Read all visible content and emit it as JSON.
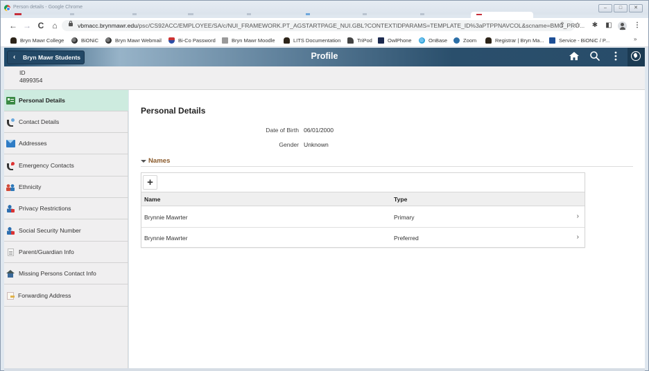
{
  "window": {
    "title": "Person details - Google Chrome",
    "controls": {
      "minimize": "–",
      "maximize": "□",
      "close": "✕"
    }
  },
  "browser": {
    "nav": {
      "back": "←",
      "forward": "→",
      "reload": "C",
      "home": "⌂"
    },
    "url_host": "vbmacc.brynmawr.edu",
    "url_path": "/psc/CS92ACC/EMPLOYEE/SA/c/NUI_FRAMEWORK.PT_AGSTARTPAGE_NUI.GBL?CONTEXTIDPARAMS=TEMPLATE_ID%3aPTPPNAVCOL&scname=BMC_PRO...",
    "icons": [
      "share-icon",
      "star-icon",
      "extensions-icon",
      "side-panel-icon",
      "profile-avatar",
      "menu-icon"
    ],
    "bookmarks": [
      {
        "label": "Bryn Mawr College",
        "icon": "owl"
      },
      {
        "label": "BiONiC",
        "icon": "globe"
      },
      {
        "label": "Bryn Mawr Webmail",
        "icon": "globe"
      },
      {
        "label": "Bi-Co Password",
        "icon": "shield"
      },
      {
        "label": "Bryn Mawr Moodle",
        "icon": "moodle"
      },
      {
        "label": "LITS Documentation",
        "icon": "owl"
      },
      {
        "label": "TriPod",
        "icon": "tripod"
      },
      {
        "label": "OwlPhone",
        "icon": "owlphone"
      },
      {
        "label": "OnBase",
        "icon": "onbase"
      },
      {
        "label": "Zoom",
        "icon": "wp"
      },
      {
        "label": "Registrar | Bryn Ma...",
        "icon": "owl"
      },
      {
        "label": "Service - BiONiC / P...",
        "icon": "td"
      }
    ],
    "bookmarks_more": "»"
  },
  "header": {
    "back_label": "Bryn Mawr Students",
    "title": "Profile",
    "icons": [
      "home-icon",
      "search-icon",
      "more-actions-icon",
      "navbar-compass-icon"
    ]
  },
  "id_bar": {
    "label": "ID",
    "value": "4899354"
  },
  "sidebar": {
    "items": [
      {
        "label": "Personal Details",
        "icon": "card",
        "active": true
      },
      {
        "label": "Contact Details",
        "icon": "phone"
      },
      {
        "label": "Addresses",
        "icon": "mail"
      },
      {
        "label": "Emergency Contacts",
        "icon": "phone-red"
      },
      {
        "label": "Ethnicity",
        "icon": "people"
      },
      {
        "label": "Privacy Restrictions",
        "icon": "person"
      },
      {
        "label": "Social Security Number",
        "icon": "person"
      },
      {
        "label": "Parent/Guardian Info",
        "icon": "doc"
      },
      {
        "label": "Missing Persons Contact Info",
        "icon": "house"
      },
      {
        "label": "Forwarding Address",
        "icon": "fwd"
      }
    ]
  },
  "main": {
    "section_title": "Personal Details",
    "fields": [
      {
        "label": "Date of Birth",
        "value": "06/01/2000"
      },
      {
        "label": "Gender",
        "value": "Unknown"
      }
    ],
    "names": {
      "toggle_label": "Names",
      "add_label": "+",
      "columns": [
        "Name",
        "Type"
      ],
      "rows": [
        {
          "name": "Brynnie Mawrter",
          "type": "Primary"
        },
        {
          "name": "Brynnie Mawrter",
          "type": "Preferred"
        }
      ],
      "row_chevron": "›"
    }
  }
}
